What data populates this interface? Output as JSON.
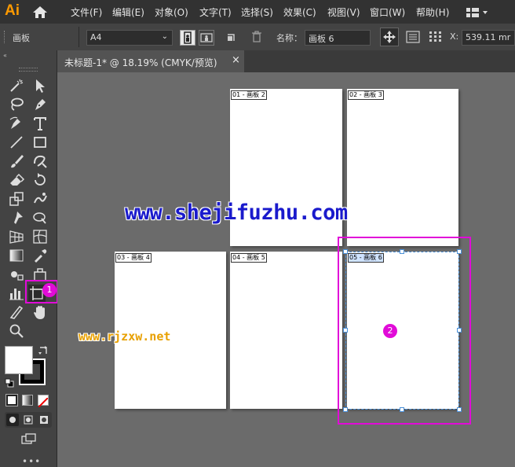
{
  "app": {
    "logo": "Ai"
  },
  "menu": [
    "文件(F)",
    "编辑(E)",
    "对象(O)",
    "文字(T)",
    "选择(S)",
    "效果(C)",
    "视图(V)",
    "窗口(W)",
    "帮助(H)"
  ],
  "control": {
    "mode_label": "画板",
    "preset_value": "A4",
    "name_label": "名称：",
    "name_value": "画板 6",
    "x_label": "X:",
    "x_value": "539.11 mr"
  },
  "tab": {
    "title": "未标题-1* @ 18.19% (CMYK/预览)",
    "close": "×"
  },
  "artboards": [
    {
      "label": "01 - 画板 2"
    },
    {
      "label": "02 - 画板 3"
    },
    {
      "label": "03 - 画板 4"
    },
    {
      "label": "04 - 画板 5"
    },
    {
      "label": "05 - 画板 6"
    }
  ],
  "watermarks": {
    "main": "www.shejifuzhu.com",
    "secondary": "www.rjzxw.net"
  },
  "badges": {
    "one": "1",
    "two": "2"
  },
  "colors": {
    "highlight": "#e10bd8",
    "watermark_blue": "#1a1acc",
    "watermark_orange": "#e8a000",
    "selection": "#4a90d9"
  }
}
